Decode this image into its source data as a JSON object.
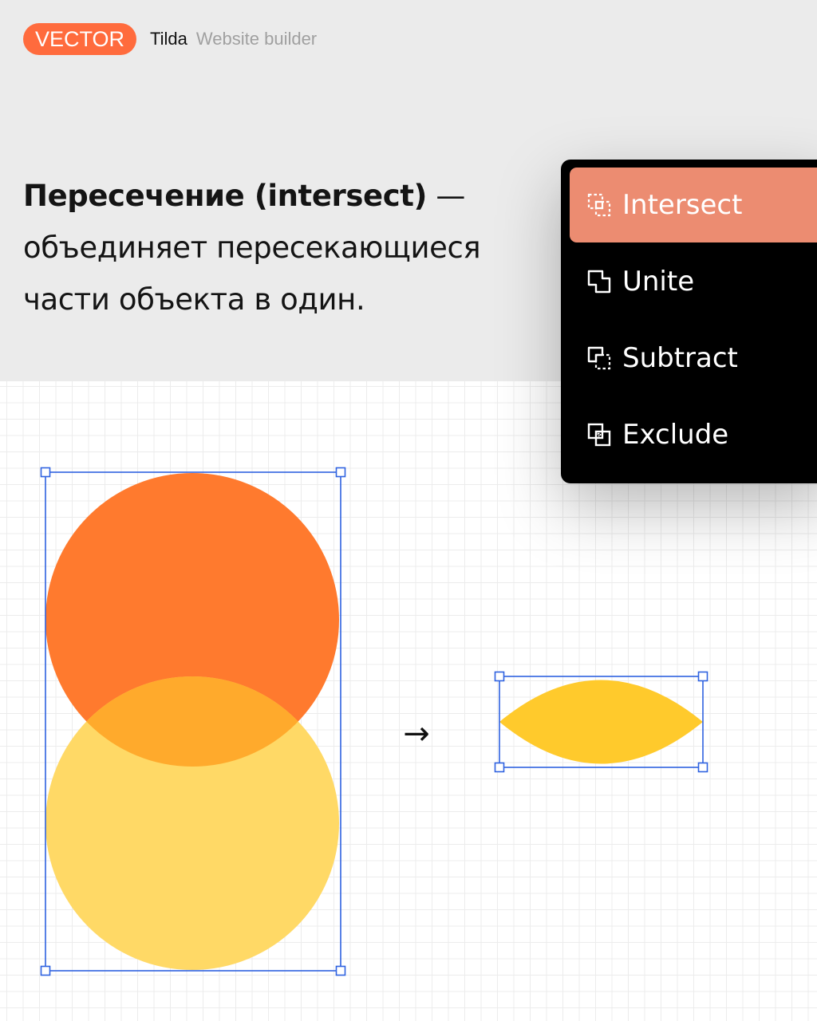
{
  "header": {
    "tag_label": "VECTOR",
    "brand": "Tilda",
    "brand_sub": "Website builder"
  },
  "headline": {
    "bold": "Пересечение (intersect)",
    "dash": " —",
    "line2": "объединяет пересекающиеся",
    "line3": "части объекта в один."
  },
  "menu": {
    "items": [
      {
        "label": "Intersect",
        "icon": "intersect-icon",
        "active": true
      },
      {
        "label": "Unite",
        "icon": "unite-icon",
        "active": false
      },
      {
        "label": "Subtract",
        "icon": "subtract-icon",
        "active": false
      },
      {
        "label": "Exclude",
        "icon": "exclude-icon",
        "active": false
      }
    ]
  },
  "canvas": {
    "arrow": "→"
  },
  "colors": {
    "accent": "#ff6b3d",
    "menu_active": "#ec8c71",
    "circle_top": "#ff7a2e",
    "circle_bottom": "#ffd966",
    "intersection": "#ffca2c",
    "selection": "#2f62e0"
  }
}
